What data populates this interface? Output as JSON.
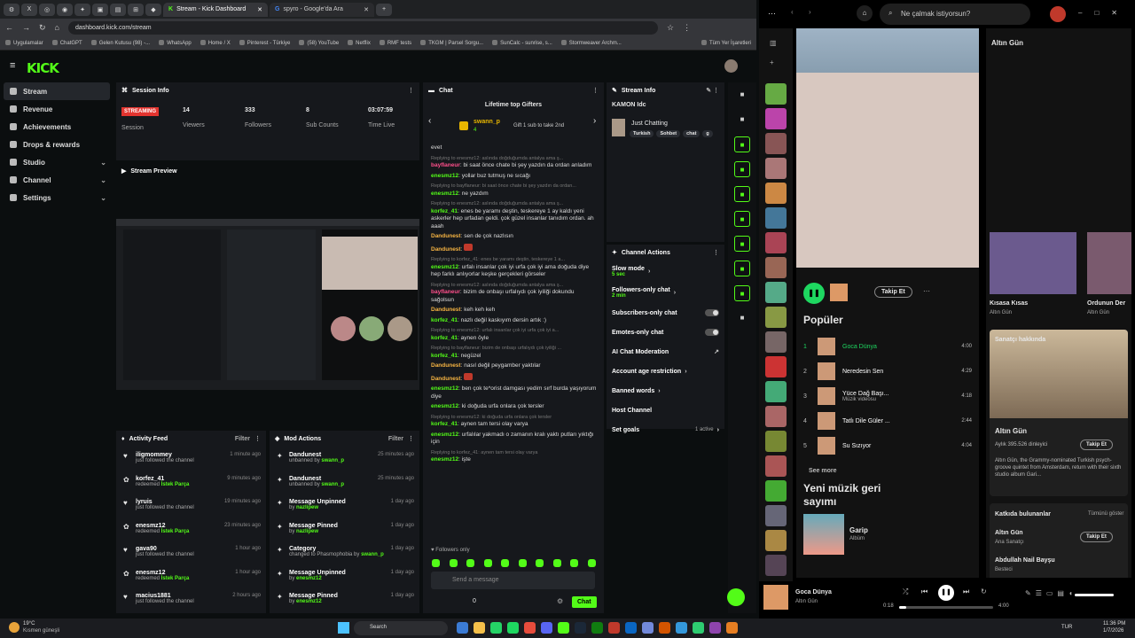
{
  "browser": {
    "active_tab": "Stream - Kick Dashboard",
    "tab2": "spyro - Google'da Ara",
    "url": "dashboard.kick.com/stream",
    "bookmarks": [
      "Uygulamalar",
      "ChatGPT",
      "Gelen Kutusu (98) -...",
      "WhatsApp",
      "Home / X",
      "Pinterest - Türkiye",
      "(58) YouTube",
      "Netflix",
      "RMF tests",
      "TKGM | Parsel Sorgu...",
      "SunCalc - sunrise, s...",
      "Stormweaver Archm..."
    ],
    "all_bookmarks": "Tüm Yer İşaretleri"
  },
  "kick": {
    "logo": "KICK",
    "beta": "BETA",
    "sidebar": [
      {
        "label": "Stream"
      },
      {
        "label": "Revenue"
      },
      {
        "label": "Achievements"
      },
      {
        "label": "Drops & rewards"
      },
      {
        "label": "Studio"
      },
      {
        "label": "Channel"
      },
      {
        "label": "Settings"
      }
    ],
    "session": {
      "title": "Session Info",
      "badge": "STREAMING",
      "status": "Session",
      "viewers": "14",
      "viewers_label": "Viewers",
      "followers": "333",
      "followers_label": "Followers",
      "subs": "8",
      "subs_label": "Sub Counts",
      "time": "03:07:59",
      "time_label": "Time Live"
    },
    "preview_title": "Stream Preview",
    "activity": {
      "title": "Activity Feed",
      "filter": "Filter",
      "items": [
        {
          "name": "iligmommey",
          "action": "just followed the channel",
          "time": "1 minute ago"
        },
        {
          "name": "korfez_41",
          "action": "redeemed",
          "extra": "İstek Parça",
          "time": "9 minutes ago"
        },
        {
          "name": "lyruis",
          "action": "just followed the channel",
          "time": "19 minutes ago"
        },
        {
          "name": "enesmz12",
          "action": "redeemed",
          "extra": "İstek Parça",
          "time": "23 minutes ago"
        },
        {
          "name": "gava90",
          "action": "just followed the channel",
          "time": "1 hour ago"
        },
        {
          "name": "enesmz12",
          "action": "redeemed",
          "extra": "İstek Parça",
          "time": "1 hour ago"
        },
        {
          "name": "macius1881",
          "action": "just followed the channel",
          "time": "2 hours ago"
        }
      ]
    },
    "mod": {
      "title": "Mod Actions",
      "filter": "Filter",
      "items": [
        {
          "name": "Dandunest",
          "action": "unbanned by",
          "by": "swann_p",
          "time": "25 minutes ago"
        },
        {
          "name": "Dandunest",
          "action": "unbanned by",
          "by": "swann_p",
          "time": "25 minutes ago"
        },
        {
          "name": "Message Unpinned",
          "action": "by",
          "by": "nazlipew",
          "time": "1 day ago"
        },
        {
          "name": "Message Pinned",
          "action": "by",
          "by": "nazlipew",
          "time": "1 day ago"
        },
        {
          "name": "Category",
          "action": "changed to Phasmophobia by",
          "by": "swann_p",
          "time": "1 day ago"
        },
        {
          "name": "Message Unpinned",
          "action": "by",
          "by": "enesmz12",
          "time": "1 day ago"
        },
        {
          "name": "Message Pinned",
          "action": "by",
          "by": "enesmz12",
          "time": "1 day ago"
        }
      ]
    },
    "chat": {
      "title": "Chat",
      "gifters_title": "Lifetime top Gifters",
      "gifter": "swann_p",
      "gifter_count": "4",
      "gift_hint": "Gift 1 sub to take 2nd",
      "followers_only": "Followers only",
      "placeholder": "Send a message",
      "send": "Chat",
      "count": "0",
      "messages": [
        {
          "reply": "",
          "user": "",
          "text": "evet"
        },
        {
          "reply": "Replying to enesmz12: aslında doğduğumda antalya ama ş...",
          "user": "bayflaneur",
          "text": "bi saat önce chate bi şey yazdın da ordan anladım"
        },
        {
          "reply": "",
          "user": "enesmz12",
          "text": "yollar buz tutmuş ne sıcağı"
        },
        {
          "reply": "Replying to bayflaneur: bi saat önce chate bi şey yazdın da ordan...",
          "user": "enesmz12",
          "text": "ne yazdım"
        },
        {
          "reply": "Replying to enesmz12: aslında doğduğumda antalya ama ş...",
          "user": "korfez_41",
          "text": "enes be yaramı deştin, teskereye 1 ay kaldı yeni askerler hep urfadan geldi. çok güzel insanlar tanıdım ordan. ah aaah"
        },
        {
          "reply": "",
          "user": "Dandunest",
          "text": "sen de çok nazlısın"
        },
        {
          "reply": "",
          "user": "Dandunest",
          "text": ""
        },
        {
          "reply": "Replying to korfez_41: enes be yaramı deştin, teskereye 1 a...",
          "user": "enesmz12",
          "text": "urfalı insanlar çok iyi urfa çok iyi ama doğuda diye hep farklı anlıyorlar keşke gerçekleri görseler"
        },
        {
          "reply": "Replying to enesmz12: aslında doğduğumda antalya ama ş...",
          "user": "bayflaneur",
          "text": "bizim de onbaşı urfalıydı çok iyiliği dokundu sağolsun"
        },
        {
          "reply": "",
          "user": "Dandunest",
          "text": "keh keh keh"
        },
        {
          "reply": "",
          "user": "korfez_41",
          "text": "nazlı değil kaskıyım dersin artık :)"
        },
        {
          "reply": "Replying to enesmz12: urfalı insanlar çok iyi urfa çok iyi a...",
          "user": "korfez_41",
          "text": "aynen öyle"
        },
        {
          "reply": "Replying to bayflaneur: bizim de onbaşı urfalıydı çok iyiliği ...",
          "user": "korfez_41",
          "text": "negüzel"
        },
        {
          "reply": "",
          "user": "Dandunest",
          "text": "nasıl değil peygamber yaktılar"
        },
        {
          "reply": "",
          "user": "Dandunest",
          "text": ""
        },
        {
          "reply": "",
          "user": "enesmz12",
          "text": "ben çok te*orist damgası yedim sırf burda yaşıyorum diye"
        },
        {
          "reply": "",
          "user": "enesmz12",
          "text": "ki doğuda urfa onlara çok tersler"
        },
        {
          "reply": "Replying to enesmz12: ki doğuda urfa onlara çok tersler",
          "user": "korfez_41",
          "text": "aynen tam tersi olay varya"
        },
        {
          "reply": "",
          "user": "enesmz12",
          "text": "urfalılar yakmadı o zamanın kralı yaktı putları yıktığı için"
        },
        {
          "reply": "Replying to korfez_41: aynen tam tersi olay varya",
          "user": "enesmz12",
          "text": "işte"
        }
      ]
    },
    "info": {
      "title": "Stream Info",
      "channel": "KAMON Idc",
      "category": "Just Chatting",
      "tags": [
        "Turkish",
        "Sohbet",
        "chat",
        "g"
      ]
    },
    "actions": {
      "title": "Channel Actions",
      "items": [
        {
          "label": "Slow mode",
          "sub": "5 sec",
          "ctl": "chev"
        },
        {
          "label": "Followers-only chat",
          "sub": "2 min",
          "ctl": "chev"
        },
        {
          "label": "Subscribers-only chat",
          "sub": "",
          "ctl": "tog"
        },
        {
          "label": "Emotes-only chat",
          "sub": "",
          "ctl": "tog"
        },
        {
          "label": "AI Chat Moderation",
          "sub": "",
          "ctl": "ext"
        },
        {
          "label": "Account age restriction",
          "sub": "",
          "ctl": "chev"
        },
        {
          "label": "Banned words",
          "sub": "",
          "ctl": "chev"
        },
        {
          "label": "Host Channel",
          "sub": "",
          "ctl": ""
        },
        {
          "label": "Set goals",
          "sub": "1 active",
          "ctl": "chev"
        }
      ]
    }
  },
  "spotify": {
    "search": "Ne çalmak istiyorsun?",
    "follow": "Takip Et",
    "popular": "Popüler",
    "see_more": "See more",
    "tracks": [
      {
        "n": "1",
        "title": "Goca Dünya",
        "plays": "",
        "dur": "4:00"
      },
      {
        "n": "2",
        "title": "Neredesin Sen",
        "plays": "",
        "dur": "4:29"
      },
      {
        "n": "3",
        "title": "Yüce Dağ Başı...",
        "plays": "Müzik videosu",
        "dur": "4:18"
      },
      {
        "n": "4",
        "title": "Tatlı Dile Güler ...",
        "plays": "",
        "dur": "2:44"
      },
      {
        "n": "5",
        "title": "Su Sızıyor",
        "plays": "",
        "dur": "4:04"
      }
    ],
    "new_title": "Yeni müzik geri sayımı",
    "new_album": "Garip",
    "new_type": "Albüm",
    "right_title": "Altın Gün",
    "albums": [
      {
        "t": "Kısasa Kısas",
        "a": "Altın Gün"
      },
      {
        "t": "Ordunun Der",
        "a": "Altın Gün"
      }
    ],
    "about": "Sanatçı hakkında",
    "artist": "Altın Gün",
    "listeners": "Aylık 395.526 dinleyici",
    "bio": "Altın Gün, the Grammy-nominated Turkish psych-groove quintet from Amsterdam, return with their sixth studio album Gari...",
    "contrib": "Katkıda bulunanlar",
    "show_all": "Tümünü göster",
    "c1": "Altın Gün",
    "c1r": "Ana Sanatçı",
    "c2": "Abdullah Nail Bayşu",
    "c2r": "Besteci",
    "now": "Goca Dünya",
    "now_artist": "Altın Gün",
    "pos": "0:18",
    "len": "4:00",
    "progress": 0.075
  },
  "taskbar": {
    "temp": "19°C",
    "weather": "Kısmen güneşli",
    "search": "Search",
    "lang": "TUR",
    "time": "11:36 PM",
    "date": "1/7/2026"
  }
}
